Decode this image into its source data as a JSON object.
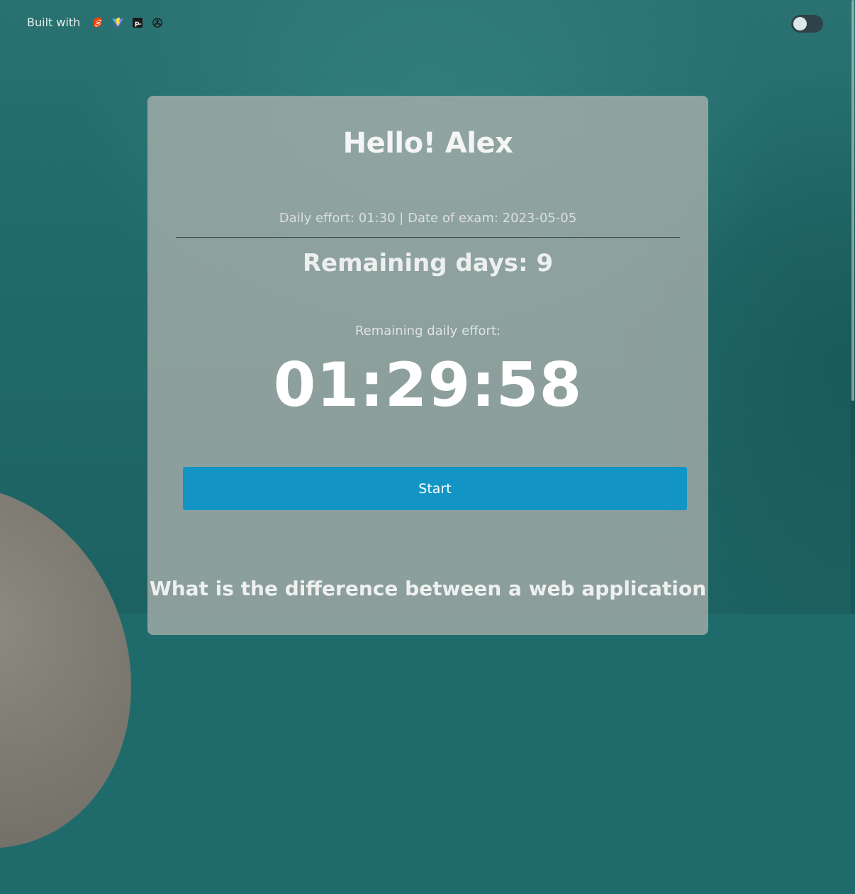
{
  "header": {
    "built_with_label": "Built with",
    "tech_icons": [
      "svelte-icon",
      "vite-icon",
      "pocketbase-icon",
      "openai-icon"
    ],
    "theme_toggle": {
      "state": "off"
    }
  },
  "card": {
    "greeting": "Hello! Alex",
    "info_line": "Daily effort: 01:30 | Date of exam: 2023-05-05",
    "remaining_days": "Remaining days: 9",
    "remaining_effort_label": "Remaining daily effort:",
    "timer": "01:29:58",
    "start_label": "Start",
    "question_heading": "What is the difference between a web application"
  },
  "colors": {
    "accent_button": "#1295c4",
    "card_bg": "rgba(170,175,172,0.78)",
    "background": "#1f6b6b"
  }
}
